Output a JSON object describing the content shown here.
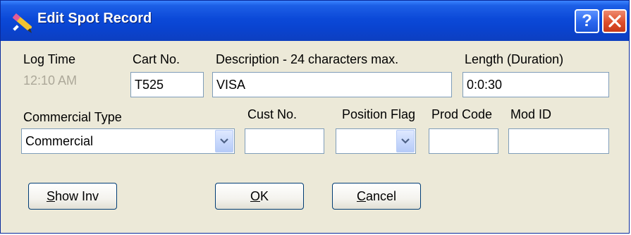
{
  "window": {
    "title": "Edit Spot Record",
    "help_glyph": "?",
    "close_glyph": "close-icon",
    "title_icon": "pencil-icon"
  },
  "fields": {
    "log_time": {
      "label": "Log Time",
      "value": "12:10 AM"
    },
    "cart_no": {
      "label": "Cart No.",
      "value": "T525"
    },
    "description": {
      "label": "Description - 24 characters max.",
      "value": "VISA"
    },
    "length": {
      "label": "Length (Duration)",
      "value": "0:0:30"
    },
    "commercial_type": {
      "label": "Commercial Type",
      "value": "Commercial"
    },
    "cust_no": {
      "label": "Cust No.",
      "value": ""
    },
    "position_flag": {
      "label": "Position Flag",
      "value": ""
    },
    "prod_code": {
      "label": "Prod Code",
      "value": ""
    },
    "mod_id": {
      "label": "Mod ID",
      "value": ""
    }
  },
  "buttons": {
    "show_inv": {
      "mnemonic": "S",
      "rest": "how Inv"
    },
    "ok": {
      "mnemonic": "O",
      "rest": "K"
    },
    "cancel": {
      "mnemonic": "C",
      "rest": "ancel"
    }
  },
  "colors": {
    "title_bar": "#0b49d8",
    "dialog_bg": "#ece9d8",
    "field_border": "#7f9db9",
    "disabled_text": "#aca899",
    "close_button": "#de4f2c"
  }
}
